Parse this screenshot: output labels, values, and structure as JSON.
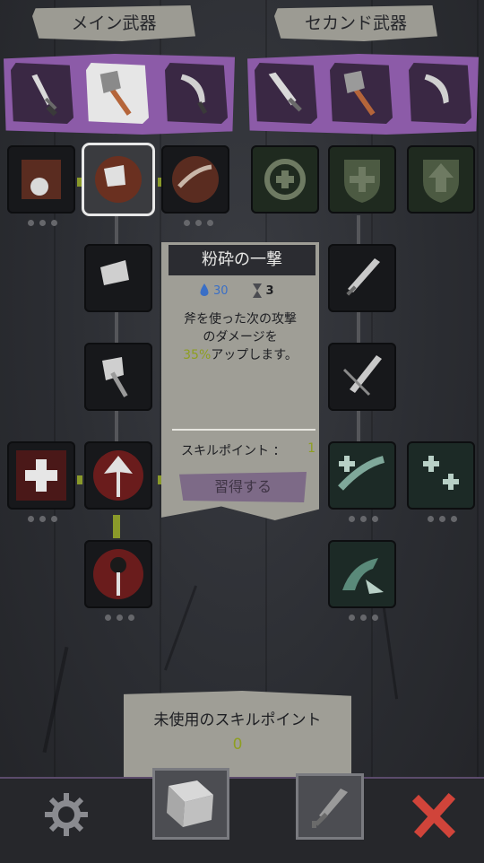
{
  "header": {
    "main_weapon": "メイン武器",
    "second_weapon": "セカンド武器"
  },
  "weapons": {
    "main": [
      {
        "icon": "dagger-icon"
      },
      {
        "icon": "axe-icon",
        "selected": true
      },
      {
        "icon": "curved-blade-icon"
      }
    ],
    "second": [
      {
        "icon": "broadsword-icon"
      },
      {
        "icon": "axe-icon"
      },
      {
        "icon": "curved-blade-icon"
      }
    ]
  },
  "tooltip": {
    "title": "粉砕の一撃",
    "mana": "30",
    "turns": "3",
    "desc_line1": "斧を使った次の攻撃",
    "desc_line2": "のダメージを",
    "desc_pct": "35%",
    "desc_line3": "アップします。",
    "skill_points_label": "スキルポイント ：",
    "skill_points_value": "1",
    "learn_button": "習得する"
  },
  "unused": {
    "label": "未使用のスキルポイント",
    "value": "0"
  },
  "colors": {
    "accent_green": "#8e9e21",
    "panel_purple": "#8c5ba8",
    "parchment": "#9f9e96",
    "close_red": "#d0443a"
  }
}
